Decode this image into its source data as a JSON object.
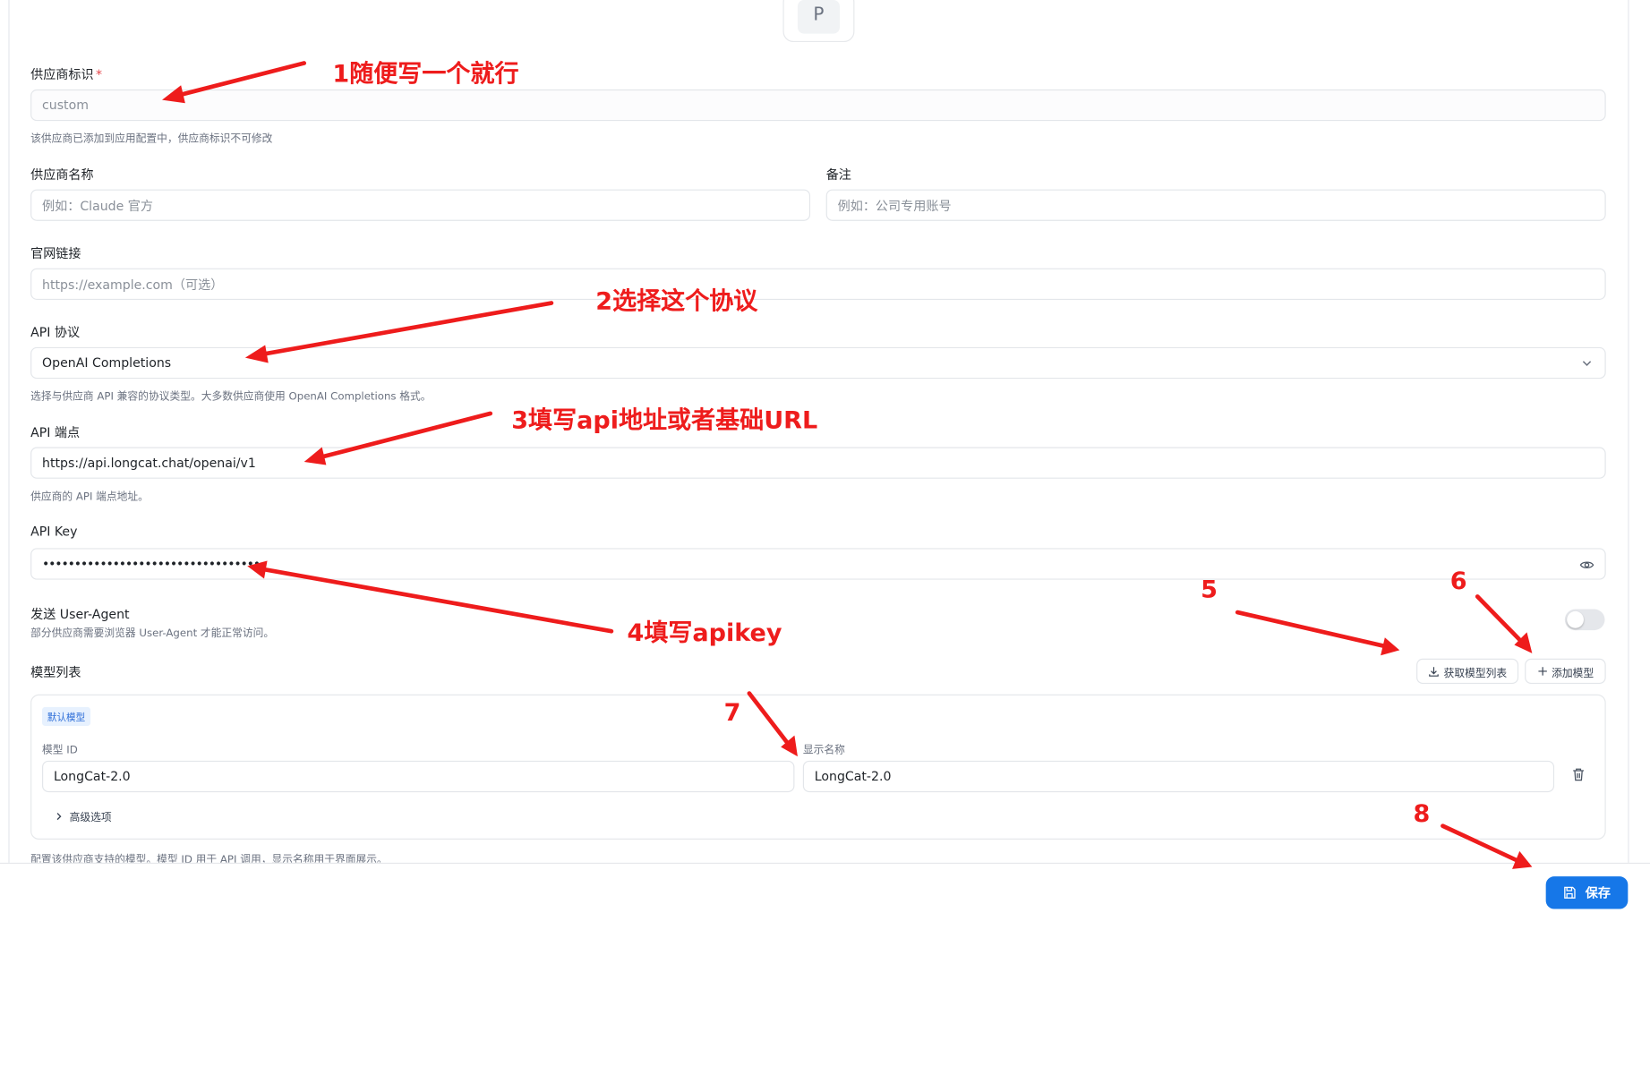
{
  "avatar": {
    "letter": "P"
  },
  "provider_id": {
    "label": "供应商标识",
    "required_mark": "*",
    "placeholder": "custom",
    "hint": "该供应商已添加到应用配置中，供应商标识不可修改"
  },
  "provider_name": {
    "label": "供应商名称",
    "placeholder": "例如：Claude 官方"
  },
  "remark": {
    "label": "备注",
    "placeholder": "例如：公司专用账号"
  },
  "website": {
    "label": "官网链接",
    "placeholder": "https://example.com（可选）"
  },
  "api_protocol": {
    "label": "API 协议",
    "value": "OpenAI Completions",
    "hint": "选择与供应商 API 兼容的协议类型。大多数供应商使用 OpenAI Completions 格式。"
  },
  "api_endpoint": {
    "label": "API 端点",
    "value": "https://api.longcat.chat/openai/v1",
    "hint": "供应商的 API 端点地址。"
  },
  "api_key": {
    "label": "API Key",
    "value": "••••••••••••••••••••••••••••••••••"
  },
  "user_agent": {
    "label": "发送 User-Agent",
    "hint": "部分供应商需要浏览器 User-Agent 才能正常访问。",
    "enabled": false
  },
  "model_list": {
    "label": "模型列表",
    "fetch_button": "获取模型列表",
    "add_button": "添加模型",
    "models": [
      {
        "badge": "默认模型",
        "id_label": "模型 ID",
        "id_value": "LongCat-2.0",
        "name_label": "显示名称",
        "name_value": "LongCat-2.0",
        "advanced": "高级选项"
      }
    ],
    "hint": "配置该供应商支持的模型。模型 ID 用于 API 调用，显示名称用于界面展示。"
  },
  "save_button": "保存",
  "annotations": {
    "a1": "1随便写一个就行",
    "a2": "2选择这个协议",
    "a3": "3填写api地址或者基础URL",
    "a4": "4填写apikey",
    "a5": "5",
    "a6": "6",
    "a7": "7",
    "a8": "8",
    "color": "#ee1c1c"
  },
  "colors": {
    "primary": "#1677e8",
    "required": "#e5484d",
    "badge_bg": "#e7f1fe"
  },
  "icons": {
    "select": "chevron-down-icon",
    "visibility": "eye-icon",
    "fetch": "download-icon",
    "add": "plus-icon",
    "delete": "trash-icon",
    "expand": "chevron-right-icon",
    "save": "save-icon"
  }
}
